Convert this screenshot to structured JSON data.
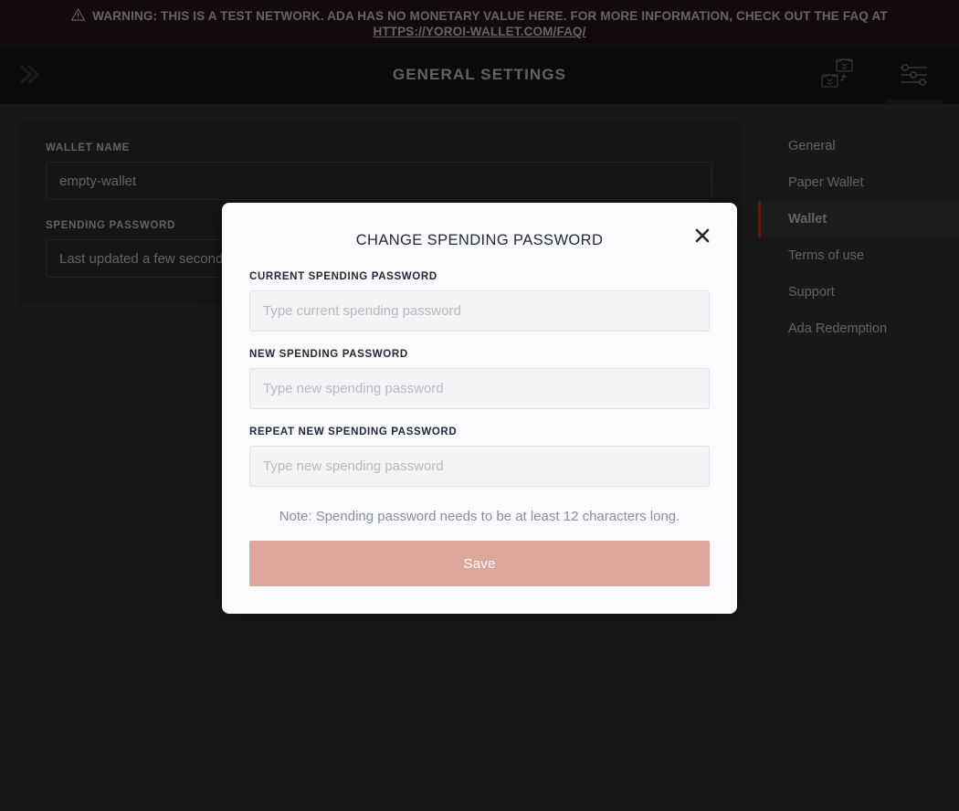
{
  "banner": {
    "icon": "warning-triangle-icon",
    "line1": "WARNING: THIS IS A TEST NETWORK. ADA HAS NO MONETARY VALUE HERE. FOR MORE INFORMATION, CHECK OUT THE FAQ AT",
    "line2": "HTTPS://YOROI-WALLET.COM/FAQ/",
    "background": "#2e1b1a"
  },
  "topbar": {
    "logo": "yoroi-logo-icon",
    "title": "GENERAL SETTINGS",
    "actions": [
      {
        "name": "wallet-switch-icon",
        "label": "Switch wallet"
      },
      {
        "name": "settings-sliders-icon",
        "label": "Settings"
      }
    ],
    "active_action": "settings-sliders-icon",
    "background": "#17171a",
    "accent": "#3b2323"
  },
  "settings": {
    "wallet_name": {
      "label": "WALLET NAME",
      "value": "empty-wallet",
      "placeholder": "Wallet name"
    },
    "spending_password": {
      "label": "SPENDING PASSWORD",
      "value": "Last updated a few seconds ago",
      "placeholder": "Spending password"
    }
  },
  "sidebar": {
    "items": [
      {
        "label": "General",
        "active": false
      },
      {
        "label": "Paper Wallet",
        "active": false
      },
      {
        "label": "Wallet",
        "active": true
      },
      {
        "label": "Terms of use",
        "active": false
      },
      {
        "label": "Support",
        "active": false
      },
      {
        "label": "Ada Redemption",
        "active": false
      }
    ],
    "active_accent": "#cc4a35"
  },
  "modal": {
    "title": "CHANGE SPENDING PASSWORD",
    "close_icon": "close-icon",
    "fields": [
      {
        "label": "CURRENT SPENDING PASSWORD",
        "placeholder": "Type current spending password",
        "value": ""
      },
      {
        "label": "NEW SPENDING PASSWORD",
        "placeholder": "Type new spending password",
        "value": ""
      },
      {
        "label": "REPEAT NEW SPENDING PASSWORD",
        "placeholder": "Type new spending password",
        "value": ""
      }
    ],
    "note": "Note: Spending password needs to be at least 12 characters long.",
    "save_label": "Save",
    "save_color": "#dba79c"
  }
}
